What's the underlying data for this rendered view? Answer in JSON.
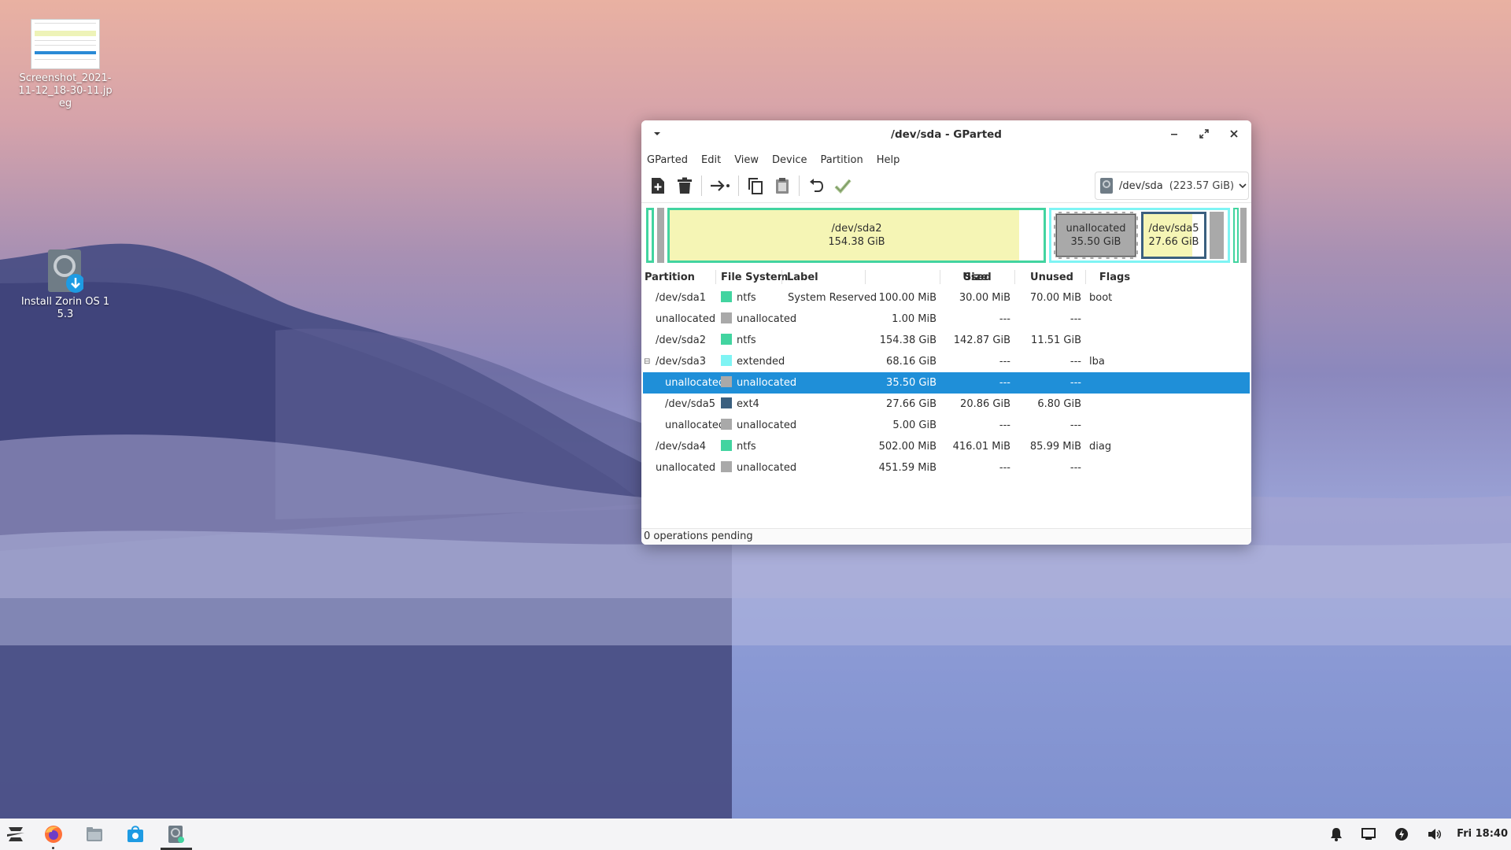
{
  "desktop": {
    "icons": [
      {
        "label": "Screenshot_2021-11-12_18-30-11.jpeg"
      },
      {
        "label": "Install Zorin OS 15.3"
      }
    ]
  },
  "window": {
    "title": "/dev/sda - GParted",
    "menu": [
      "GParted",
      "Edit",
      "View",
      "Device",
      "Partition",
      "Help"
    ],
    "device_selector": {
      "device": "/dev/sda",
      "size": "(223.57 GiB)"
    },
    "status": "0 operations pending"
  },
  "diskmap": {
    "sda2": {
      "name": "/dev/sda2",
      "size": "154.38 GiB"
    },
    "unallocated": {
      "name": "unallocated",
      "size": "35.50 GiB"
    },
    "sda5": {
      "name": "/dev/sda5",
      "size": "27.66 GiB"
    }
  },
  "table": {
    "headers": [
      "Partition",
      "File System",
      "Label",
      "Size",
      "Used",
      "Unused",
      "Flags"
    ],
    "rows": [
      {
        "partition": "/dev/sda1",
        "fs": "ntfs",
        "label": "System Reserved",
        "size": "100.00 MiB",
        "used": "30.00 MiB",
        "unused": "70.00 MiB",
        "flags": "boot"
      },
      {
        "partition": "unallocated",
        "fs": "unallocated",
        "label": "",
        "size": "1.00 MiB",
        "used": "---",
        "unused": "---",
        "flags": ""
      },
      {
        "partition": "/dev/sda2",
        "fs": "ntfs",
        "label": "",
        "size": "154.38 GiB",
        "used": "142.87 GiB",
        "unused": "11.51 GiB",
        "flags": ""
      },
      {
        "partition": "/dev/sda3",
        "fs": "extended",
        "label": "",
        "size": "68.16 GiB",
        "used": "---",
        "unused": "---",
        "flags": "lba"
      },
      {
        "partition": "unallocated",
        "fs": "unallocated",
        "label": "",
        "size": "35.50 GiB",
        "used": "---",
        "unused": "---",
        "flags": ""
      },
      {
        "partition": "/dev/sda5",
        "fs": "ext4",
        "label": "",
        "size": "27.66 GiB",
        "used": "20.86 GiB",
        "unused": "6.80 GiB",
        "flags": ""
      },
      {
        "partition": "unallocated",
        "fs": "unallocated",
        "label": "",
        "size": "5.00 GiB",
        "used": "---",
        "unused": "---",
        "flags": ""
      },
      {
        "partition": "/dev/sda4",
        "fs": "ntfs",
        "label": "",
        "size": "502.00 MiB",
        "used": "416.01 MiB",
        "unused": "85.99 MiB",
        "flags": "diag"
      },
      {
        "partition": "unallocated",
        "fs": "unallocated",
        "label": "",
        "size": "451.59 MiB",
        "used": "---",
        "unused": "---",
        "flags": ""
      }
    ]
  },
  "colors": {
    "ntfs": "#42d4a0",
    "unallocated": "#a9a9a9",
    "extended": "#7ff4f4",
    "ext4": "#3a5f7f",
    "selection": "#1f8fd8"
  },
  "taskbar": {
    "clock": "Fri 18:40"
  }
}
